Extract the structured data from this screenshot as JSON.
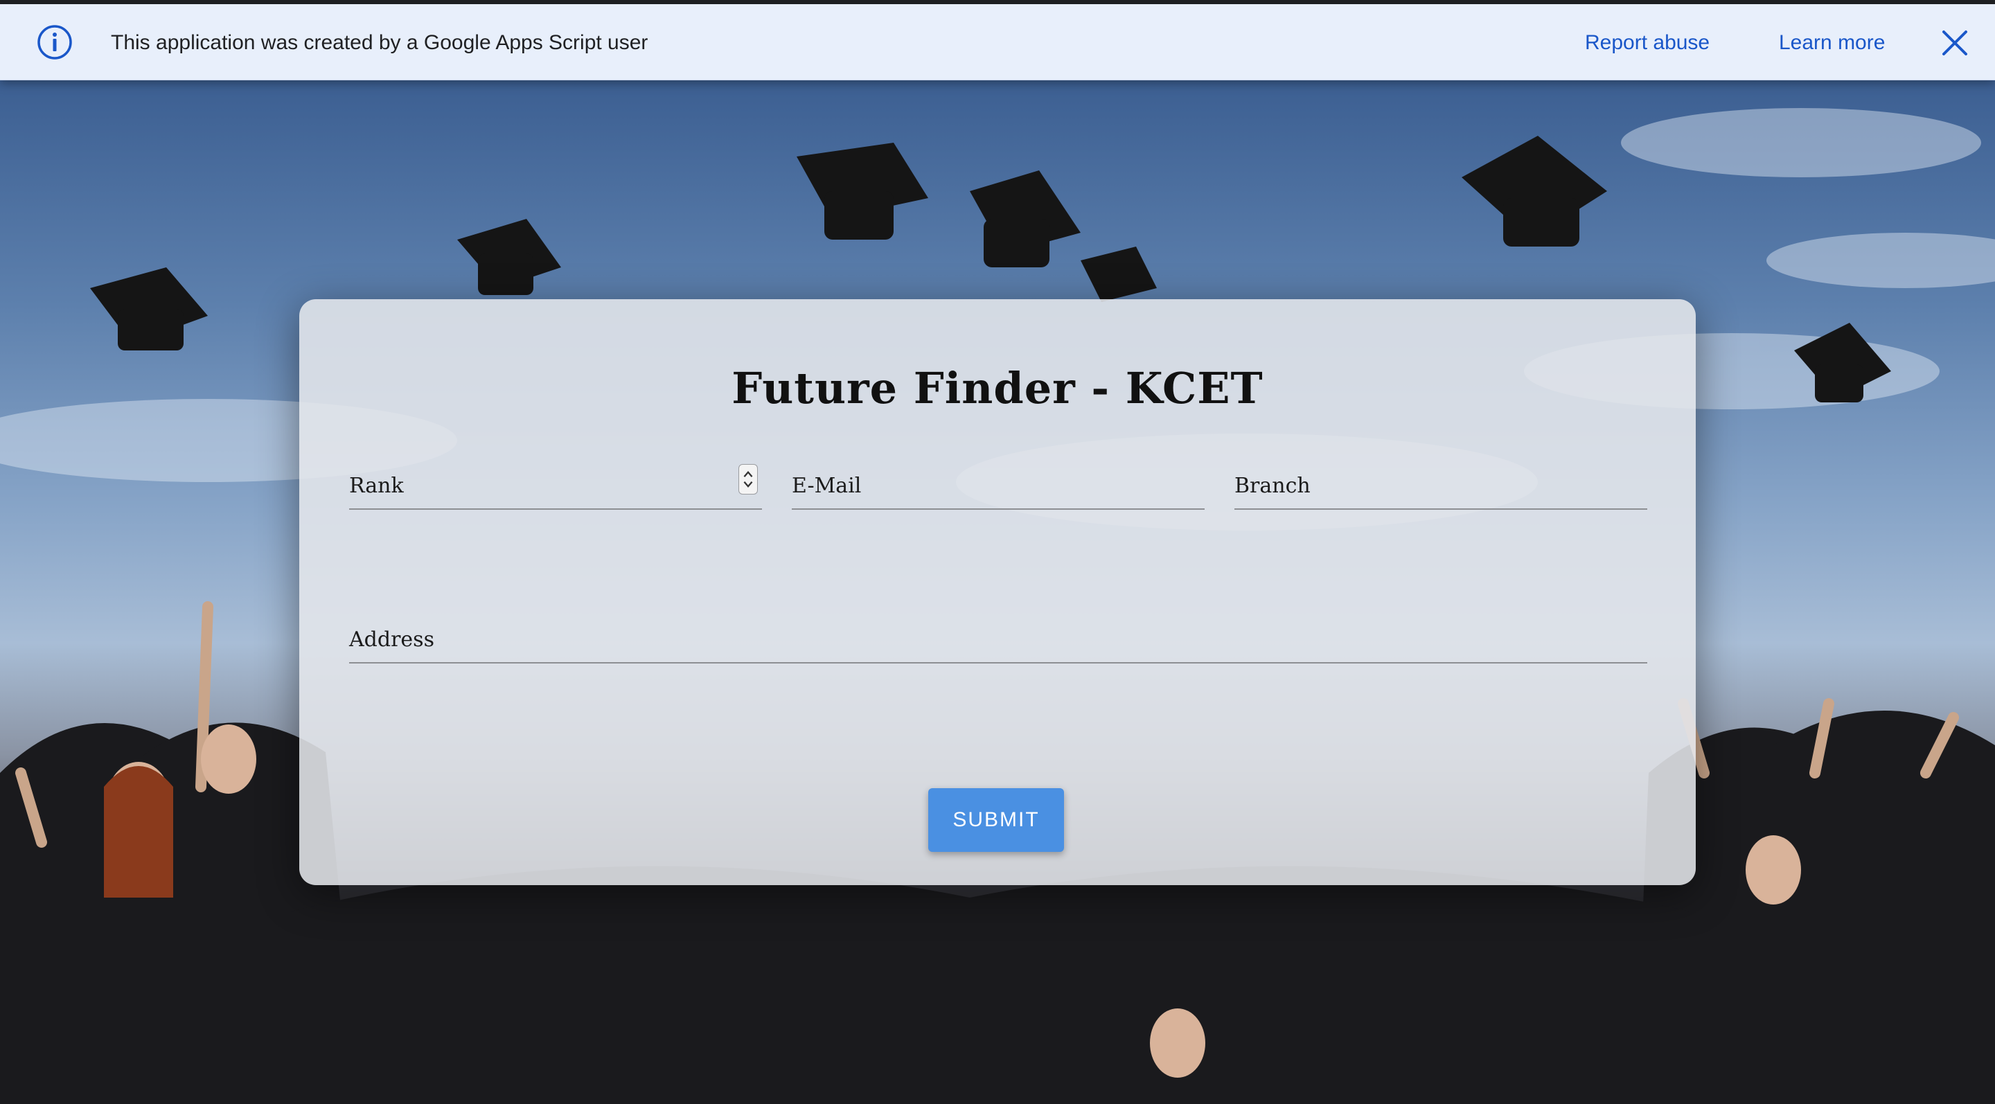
{
  "banner": {
    "message": "This application was created by a Google Apps Script user",
    "report_abuse": "Report abuse",
    "learn_more": "Learn more",
    "info_icon": "info-icon",
    "close_icon": "close-icon",
    "link_color": "#1a57c9",
    "background_color": "#e8effb"
  },
  "form": {
    "title": "Future Finder - KCET",
    "fields": {
      "rank": {
        "label": "Rank",
        "value": ""
      },
      "email": {
        "label": "E-Mail",
        "value": ""
      },
      "branch": {
        "label": "Branch",
        "value": ""
      },
      "address": {
        "label": "Address",
        "value": ""
      }
    },
    "submit_label": "SUBMIT",
    "accent_color": "#4a90e2"
  },
  "background": {
    "icon": "graduation-photo"
  }
}
